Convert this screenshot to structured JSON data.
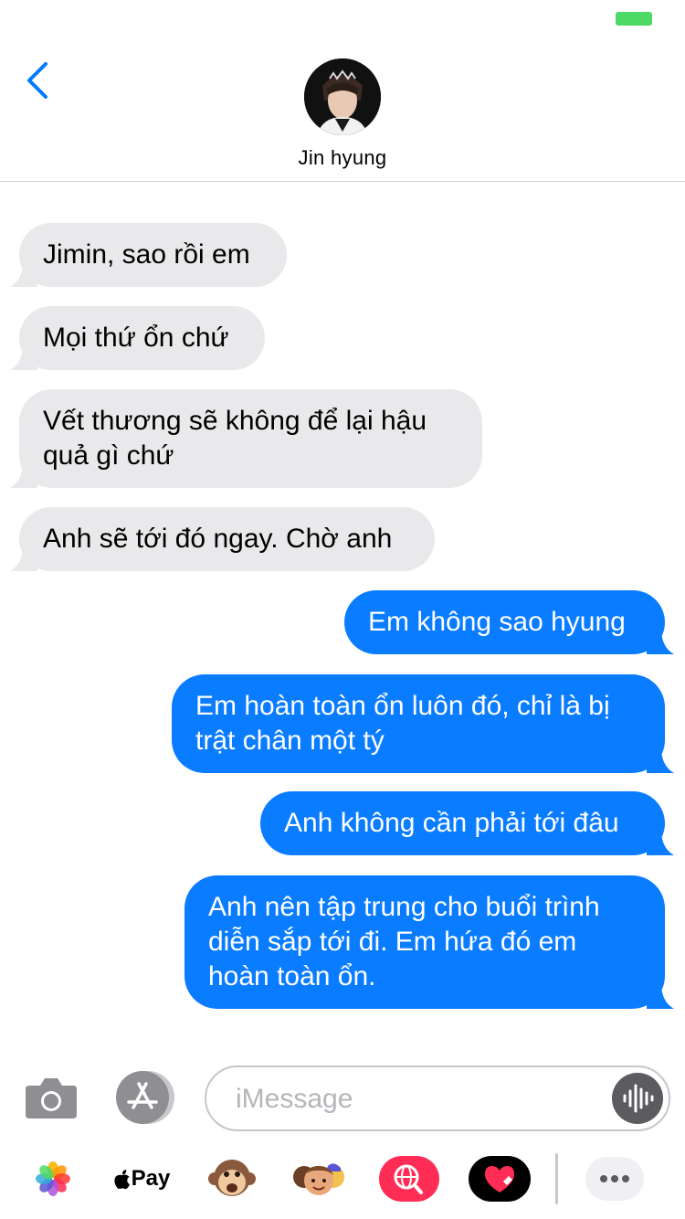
{
  "status_bar": {
    "battery_color": "#4cd964"
  },
  "header": {
    "back_icon": "chevron-left-icon",
    "contact_name": "Jin hyung",
    "avatar_icon": "contact-avatar"
  },
  "colors": {
    "incoming_bubble": "#e9e9eb",
    "outgoing_bubble": "#0a7cff",
    "accent": "#007aff"
  },
  "messages": [
    {
      "direction": "incoming",
      "text": "Jimin, sao rồi em"
    },
    {
      "direction": "incoming",
      "text": "Mọi thứ ổn chứ"
    },
    {
      "direction": "incoming",
      "text": "Vết thương sẽ không để lại hậu quả gì chứ"
    },
    {
      "direction": "incoming",
      "text": "Anh sẽ tới đó ngay. Chờ anh"
    },
    {
      "direction": "outgoing",
      "text": "Em không sao hyung"
    },
    {
      "direction": "outgoing",
      "text": "Em hoàn toàn ổn luôn đó, chỉ là bị trật chân một tý"
    },
    {
      "direction": "outgoing",
      "text": "Anh không cần phải tới đâu"
    },
    {
      "direction": "outgoing",
      "text": "Anh nên tập trung cho buổi trình diễn sắp tới đi. Em hứa đó em hoàn toàn ổn."
    }
  ],
  "composer": {
    "placeholder": "iMessage",
    "value": "",
    "camera_icon": "camera-icon",
    "appstore_icon": "app-store-icon",
    "audio_icon": "audio-waveform-icon"
  },
  "app_drawer": {
    "items": [
      {
        "name": "photos",
        "icon": "photos-icon"
      },
      {
        "name": "apple-pay",
        "icon": "apple-logo-icon",
        "label": "Pay"
      },
      {
        "name": "animoji",
        "icon": "monkey-animoji-icon"
      },
      {
        "name": "memoji",
        "icon": "memoji-stickers-icon"
      },
      {
        "name": "images-search",
        "icon": "globe-search-icon"
      },
      {
        "name": "digital-touch",
        "icon": "heart-touch-icon"
      },
      {
        "name": "more",
        "icon": "more-icon"
      }
    ]
  }
}
